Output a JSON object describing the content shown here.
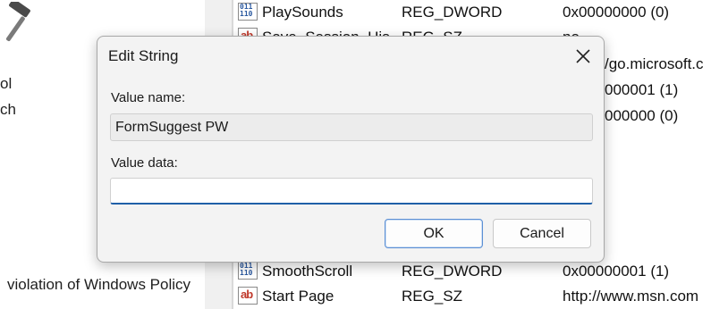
{
  "left_pane": {
    "line1": "ol",
    "line2": "ch",
    "policy_text": "violation of Windows Policy"
  },
  "registry": {
    "rows_top": [
      {
        "icon": "binary-value-icon",
        "name": "PlaySounds",
        "type": "REG_DWORD",
        "data": "0x00000000 (0)"
      },
      {
        "icon": "string-value-icon",
        "name": "Save_Session_His",
        "type": "REG_SZ",
        "data": "no"
      }
    ],
    "orphans": [
      "/go.microsoft.c",
      "000001 (1)",
      "000000 (0)"
    ],
    "rows_bottom": [
      {
        "icon": "binary-value-icon",
        "name": "SmoothScroll",
        "type": "REG_DWORD",
        "data": "0x00000001 (1)"
      },
      {
        "icon": "string-value-icon",
        "name": "Start Page",
        "type": "REG_SZ",
        "data": "http://www.msn.com"
      }
    ]
  },
  "dialog": {
    "title": "Edit String",
    "value_name_label": "Value name:",
    "value_name": "FormSuggest PW",
    "value_data_label": "Value data:",
    "value_data": "",
    "ok_label": "OK",
    "cancel_label": "Cancel"
  },
  "colors": {
    "accent": "#1f5fa8",
    "dialog_bg": "#f3f3f3",
    "string_icon": "#c0392b",
    "binary_icon": "#2c5aa0"
  }
}
